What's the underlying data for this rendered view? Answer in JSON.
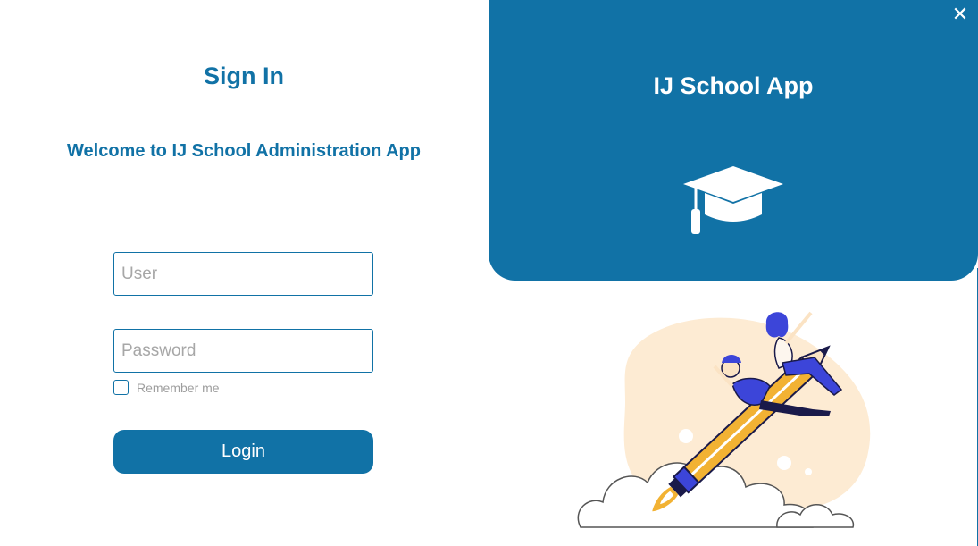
{
  "signin": {
    "title": "Sign In",
    "welcome": "Welcome to IJ School Administration App",
    "user_placeholder": "User",
    "password_placeholder": "Password",
    "remember_label": "Remember me",
    "login_label": "Login"
  },
  "panel": {
    "app_title": "IJ School App",
    "close_icon": "close-icon",
    "logo_icon": "graduation-cap-icon",
    "illustration": "students-riding-pencil-rocket"
  },
  "colors": {
    "primary": "#1172a6",
    "background": "#ffffff",
    "accent_yellow": "#f2b233",
    "illustration_blue": "#3c45d9",
    "blob_cream": "#fdebd3"
  }
}
